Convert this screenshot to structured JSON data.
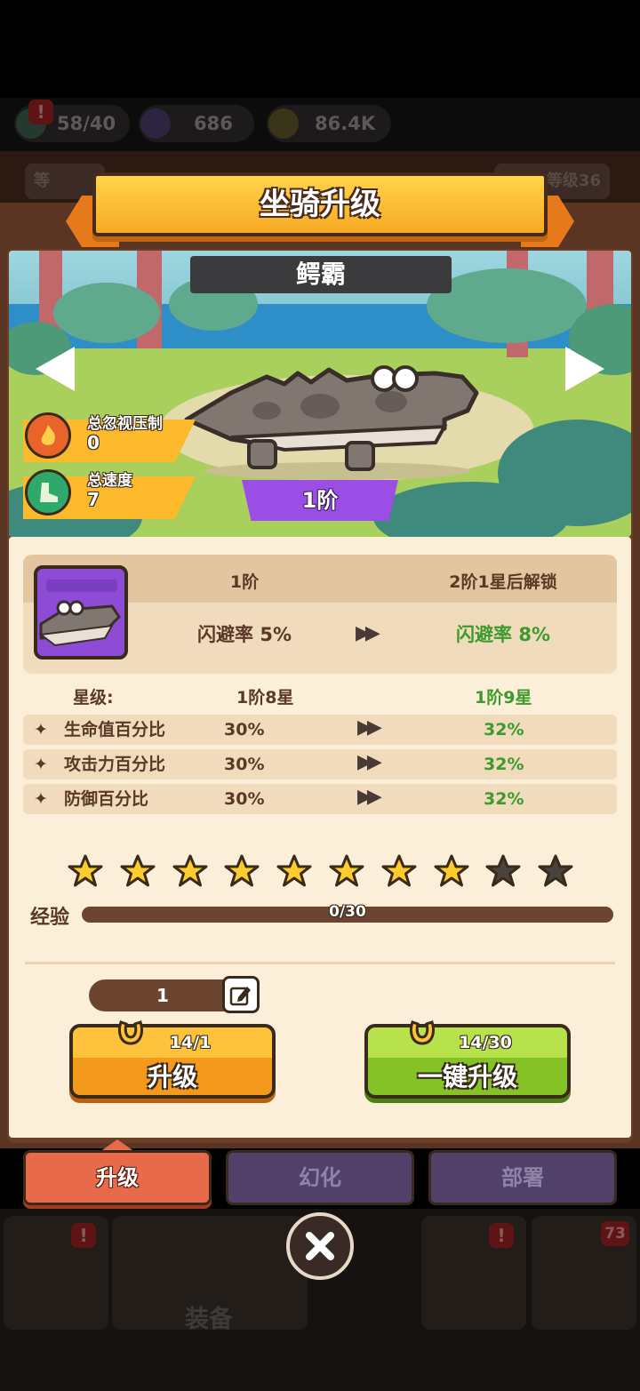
{
  "resources": {
    "energy": "58/40",
    "gems": "686",
    "gold": "86.4K"
  },
  "background": {
    "level_chip": "等级36",
    "left_chip": "等",
    "nav_equipment_label": "装备",
    "nav_badge_count": "73",
    "alert": "!"
  },
  "dialog": {
    "title": "坐骑升级",
    "mount_name": "鳄霸",
    "stage_badge": "1阶"
  },
  "scene_stats": {
    "suppress_label": "总忽视压制",
    "suppress_value": "0",
    "speed_label": "总速度",
    "speed_value": "7"
  },
  "skill": {
    "current_stage": "1阶",
    "next_unlock": "2阶1星后解锁",
    "current_effect": "闪避率 5%",
    "next_effect": "闪避率 8%"
  },
  "star_row": {
    "label": "星级:",
    "current": "1阶8星",
    "next": "1阶9星"
  },
  "stats": [
    {
      "name": "生命值百分比",
      "current": "30%",
      "next": "32%"
    },
    {
      "name": "攻击力百分比",
      "current": "30%",
      "next": "32%"
    },
    {
      "name": "防御百分比",
      "current": "30%",
      "next": "32%"
    }
  ],
  "stars": {
    "filled": 8,
    "total": 10
  },
  "experience": {
    "label": "经验",
    "text": "0/30",
    "progress": 0
  },
  "upgrade": {
    "quantity": "1",
    "upgrade_cost": "14/1",
    "upgrade_label": "升级",
    "auto_cost": "14/30",
    "auto_label": "一键升级"
  },
  "tabs": {
    "upgrade": "升级",
    "transform": "幻化",
    "deploy": "部署"
  },
  "colors": {
    "accent_orange": "#f39a1c",
    "accent_green": "#84c227",
    "next_value_green": "#3e9a2c",
    "stage_purple": "#9b4ee6",
    "active_tab": "#e76a4b"
  }
}
